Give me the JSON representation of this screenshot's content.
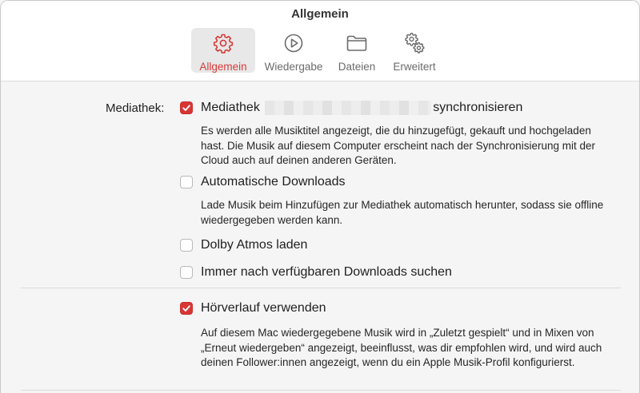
{
  "window": {
    "title": "Allgemein"
  },
  "toolbar": {
    "items": [
      {
        "label": "Allgemein",
        "icon": "gear-icon",
        "selected": true
      },
      {
        "label": "Wiedergabe",
        "icon": "play-circle-icon",
        "selected": false
      },
      {
        "label": "Dateien",
        "icon": "folder-icon",
        "selected": false
      },
      {
        "label": "Erweitert",
        "icon": "gears-icon",
        "selected": false
      }
    ]
  },
  "colors": {
    "accent": "#d93535",
    "background": "#f5f5f5"
  },
  "library": {
    "section_label": "Mediathek:",
    "sync": {
      "checked": true,
      "label_prefix": "Mediathek",
      "label_suffix": "synchronisieren",
      "description": "Es werden alle Musiktitel angezeigt, die du hinzugefügt, gekauft und hochgeladen hast. Die Musik auf diesem Computer erscheint nach der Synchronisierung mit der Cloud auch auf deinen anderen Geräten."
    },
    "auto_downloads": {
      "checked": false,
      "label": "Automatische Downloads",
      "description": "Lade Musik beim Hinzufügen zur Mediathek automatisch herunter, sodass sie offline wiedergegeben werden kann."
    },
    "dolby_atmos": {
      "checked": false,
      "label": "Dolby Atmos laden"
    },
    "check_downloads": {
      "checked": false,
      "label": "Immer nach verfügbaren Downloads suchen"
    }
  },
  "history": {
    "use_history": {
      "checked": true,
      "label": "Hörverlauf verwenden",
      "description": "Auf diesem Mac wiedergegebene Musik wird in „Zuletzt gespielt“ und in Mixen von „Erneut wiedergeben“ angezeigt, beeinflusst, was dir empfohlen wird, und wird auch deinen Follower:innen angezeigt, wenn du ein Apple Musik-Profil konfigurierst."
    }
  }
}
